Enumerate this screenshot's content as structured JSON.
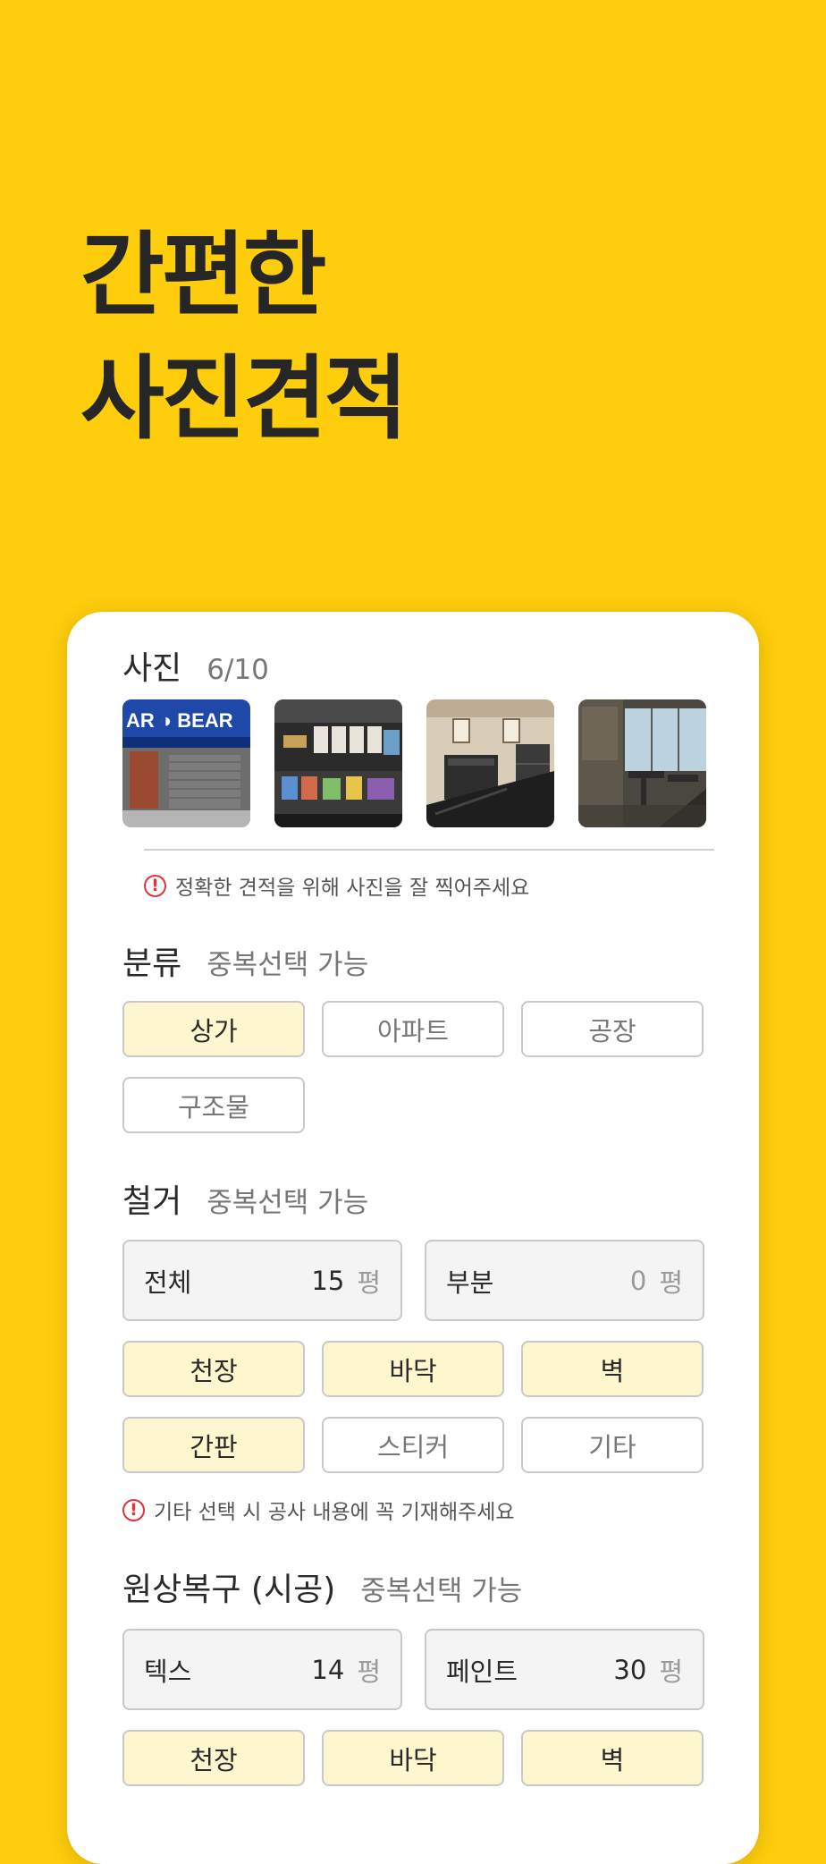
{
  "headline": {
    "line1": "간편한",
    "line2": "사진견적"
  },
  "photos": {
    "title": "사진",
    "count": "6/10",
    "thumb_sign_text": "AR ◑ BEAR",
    "notice_icon": "!",
    "notice": "정확한 견적을 위해 사진을 잘 찍어주세요"
  },
  "category": {
    "title": "분류",
    "sub": "중복선택 가능",
    "options": [
      {
        "label": "상가",
        "selected": true
      },
      {
        "label": "아파트",
        "selected": false
      },
      {
        "label": "공장",
        "selected": false
      },
      {
        "label": "구조물",
        "selected": false
      }
    ]
  },
  "demolition": {
    "title": "철거",
    "sub": "중복선택 가능",
    "whole": {
      "label": "전체",
      "value": "15",
      "unit": "평"
    },
    "partial": {
      "label": "부분",
      "value": "0",
      "unit": "평"
    },
    "options": [
      {
        "label": "천장",
        "selected": true
      },
      {
        "label": "바닥",
        "selected": true
      },
      {
        "label": "벽",
        "selected": true
      },
      {
        "label": "간판",
        "selected": true
      },
      {
        "label": "스티커",
        "selected": false
      },
      {
        "label": "기타",
        "selected": false
      }
    ],
    "notice_icon": "!",
    "notice": "기타 선택 시 공사 내용에 꼭 기재해주세요"
  },
  "restoration": {
    "title": "원상복구 (시공)",
    "sub": "중복선택 가능",
    "tex": {
      "label": "텍스",
      "value": "14",
      "unit": "평"
    },
    "paint": {
      "label": "페인트",
      "value": "30",
      "unit": "평"
    },
    "options": [
      {
        "label": "천장",
        "selected": true
      },
      {
        "label": "바닥",
        "selected": true
      },
      {
        "label": "벽",
        "selected": true
      }
    ]
  },
  "colors": {
    "background": "#FECD0C",
    "selected_chip": "#FDF6CE",
    "warning": "#E0343A"
  }
}
